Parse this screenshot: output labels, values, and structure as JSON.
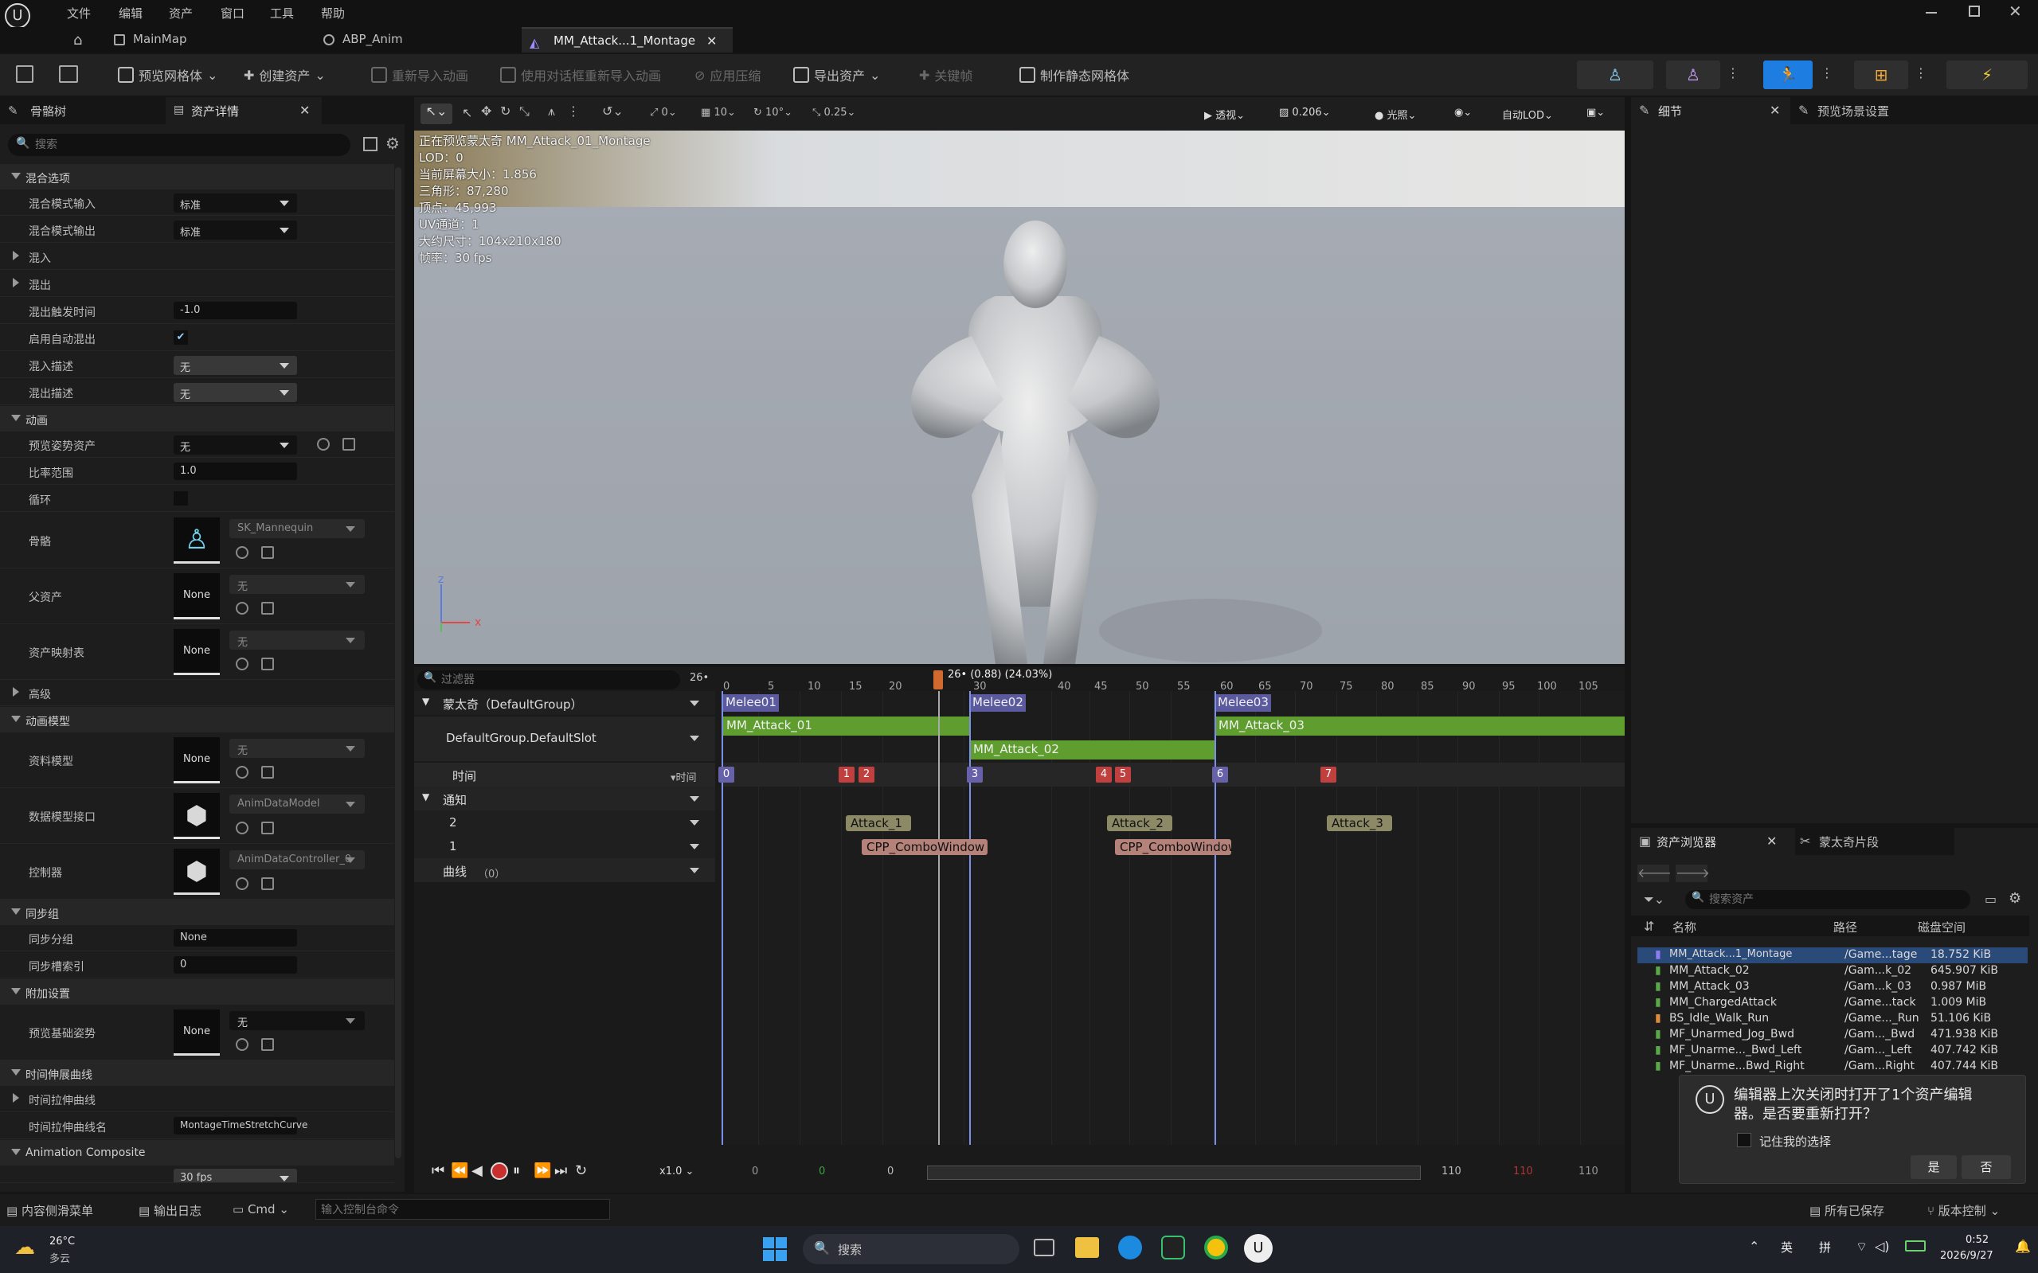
{
  "menu": {
    "items": [
      "文件",
      "编辑",
      "资产",
      "窗口",
      "工具",
      "帮助"
    ]
  },
  "tabs": [
    {
      "label": "MainMap"
    },
    {
      "label": "ABP_Anim"
    },
    {
      "label": "MM_Attack...1_Montage"
    }
  ],
  "toolbar": {
    "preview_mesh": "预览网格体",
    "create_asset": "创建资产",
    "reimport": "重新导入动画",
    "reimport_dialog": "使用对话框重新导入动画",
    "apply_compression": "应用压缩",
    "export_asset": "导出资产",
    "keyframe": "关键帧",
    "make_static_mesh": "制作静态网格体"
  },
  "left": {
    "tab_skeleton": "骨骼树",
    "tab_details": "资产详情",
    "search_placeholder": "搜索",
    "cat_blend": "混合选项",
    "blend_in_mode": "混合模式输入",
    "blend_in_mode_val": "标准",
    "blend_out_mode": "混合模式输出",
    "blend_out_mode_val": "标准",
    "blend_in": "混入",
    "blend_out": "混出",
    "blend_out_trigger": "混出触发时间",
    "blend_out_trigger_val": "-1.0",
    "auto_blend_out": "启用自动混出",
    "blend_in_profile": "混入描述",
    "blend_in_profile_val": "无",
    "blend_out_profile": "混出描述",
    "blend_out_profile_val": "无",
    "cat_anim": "动画",
    "preview_pose": "预览姿势资产",
    "preview_pose_val": "无",
    "rate_scale": "比率范围",
    "rate_scale_val": "1.0",
    "loop": "循环",
    "skeleton": "骨骼",
    "skeleton_val": "SK_Mannequin",
    "parent": "父资产",
    "parent_val": "无",
    "asset_map": "资产映射表",
    "asset_map_val": "无",
    "advanced": "高级",
    "cat_anim_model": "动画模型",
    "data_model": "资料模型",
    "data_model_val": "无",
    "data_iface": "数据模型接口",
    "data_iface_val": "AnimDataModel",
    "controller": "控制器",
    "controller_val": "AnimDataController_0",
    "cat_sync": "同步组",
    "sync_group": "同步分组",
    "sync_group_val": "None",
    "sync_index": "同步槽索引",
    "sync_index_val": "0",
    "cat_extra": "附加设置",
    "preview_base": "预览基础姿势",
    "preview_base_val": "无",
    "cat_ts": "时间伸展曲线",
    "ts_curve": "时间拉伸曲线",
    "ts_name": "时间拉伸曲线名",
    "ts_name_val": "MontageTimeStretchCurve",
    "cat_composite": "Animation Composite",
    "none": "None",
    "fps_hint": "30 fps"
  },
  "viewport": {
    "toolbar": {
      "v0": "0",
      "v10": "10",
      "deg": "10°",
      "scale": "0.25",
      "persp": "透视",
      "fov": "0.206",
      "lit": "光照",
      "lod": "自动LOD"
    },
    "info": [
      "正在预览蒙太奇 MM_Attack_01_Montage",
      "LOD：0",
      "当前屏幕大小：1.856",
      "三角形：87,280",
      "顶点：45,993",
      "UV通道：1",
      "大约尺寸：104x210x180",
      "帧率：30 fps"
    ]
  },
  "timeline": {
    "filter_placeholder": "过滤器",
    "frame": "26•",
    "playhead": "26• (0.88) (24.03%)",
    "ruler": [
      "0",
      "5",
      "10",
      "15",
      "20",
      "30",
      "40",
      "45",
      "50",
      "55",
      "60",
      "65",
      "70",
      "75",
      "80",
      "85",
      "90",
      "95",
      "100",
      "105"
    ],
    "montage": "蒙太奇（DefaultGroup）",
    "slot": "DefaultGroup.DefaultSlot",
    "time": "时间",
    "time_tag": "时间",
    "notify": "通知",
    "n2": "2",
    "n1": "1",
    "curve": "曲线",
    "curve_count": "（0）",
    "sections": [
      "Melee01",
      "Melee02",
      "Melee03"
    ],
    "clips": [
      "MM_Attack_01",
      "MM_Attack_02",
      "MM_Attack_03"
    ],
    "markers": [
      "0",
      "1",
      "2",
      "3",
      "4",
      "5",
      "6",
      "7"
    ],
    "notifies": [
      "Attack_1",
      "Attack_2",
      "Attack_3"
    ],
    "states": [
      "CPP_ComboWindow",
      "CPP_ComboWindow"
    ],
    "speed": "x1.0",
    "r0": "0",
    "r1": "0",
    "r2": "0",
    "r3": "110",
    "r4": "110",
    "r5": "110"
  },
  "right": {
    "tab_details": "细节",
    "tab_preview": "预览场景设置"
  },
  "assets": {
    "tab": "资产浏览器",
    "tab2": "蒙太奇片段",
    "search_placeholder": "搜索资产",
    "cols": [
      "名称",
      "路径",
      "磁盘空间"
    ],
    "rows": [
      [
        "MM_Attack...1_Montage",
        "/Game...tage",
        "18.752 KiB"
      ],
      [
        "MM_Attack_02",
        "/Gam...k_02",
        "645.907 KiB"
      ],
      [
        "MM_Attack_03",
        "/Gam...k_03",
        "0.987 MiB"
      ],
      [
        "MM_ChargedAttack",
        "/Game...tack",
        "1.009 MiB"
      ],
      [
        "BS_Idle_Walk_Run",
        "/Game..._Run",
        "51.106 KiB"
      ],
      [
        "MF_Unarmed_Jog_Bwd",
        "/Gam..._Bwd",
        "471.938 KiB"
      ],
      [
        "MF_Unarme..._Bwd_Left",
        "/Gam..._Left",
        "407.742 KiB"
      ],
      [
        "MF_Unarme...Bwd_Right",
        "/Gam...Right",
        "407.744 KiB"
      ]
    ]
  },
  "dialog": {
    "msg1": "编辑器上次关闭时打开了1个资产编辑",
    "msg2": "器。是否要重新打开？",
    "remember": "记住我的选择",
    "yes": "是",
    "no": "否"
  },
  "bottom": {
    "content_drawer": "内容侧滑菜单",
    "output_log": "输出日志",
    "cmd": "Cmd",
    "console_placeholder": "输入控制台命令",
    "saved": "所有已保存",
    "vcs": "版本控制"
  },
  "taskbar": {
    "temp": "26°C",
    "weather": "多云",
    "search": "搜索",
    "ime1": "英",
    "ime2": "拼",
    "time": "0:52",
    "date": "2026/9/27"
  }
}
